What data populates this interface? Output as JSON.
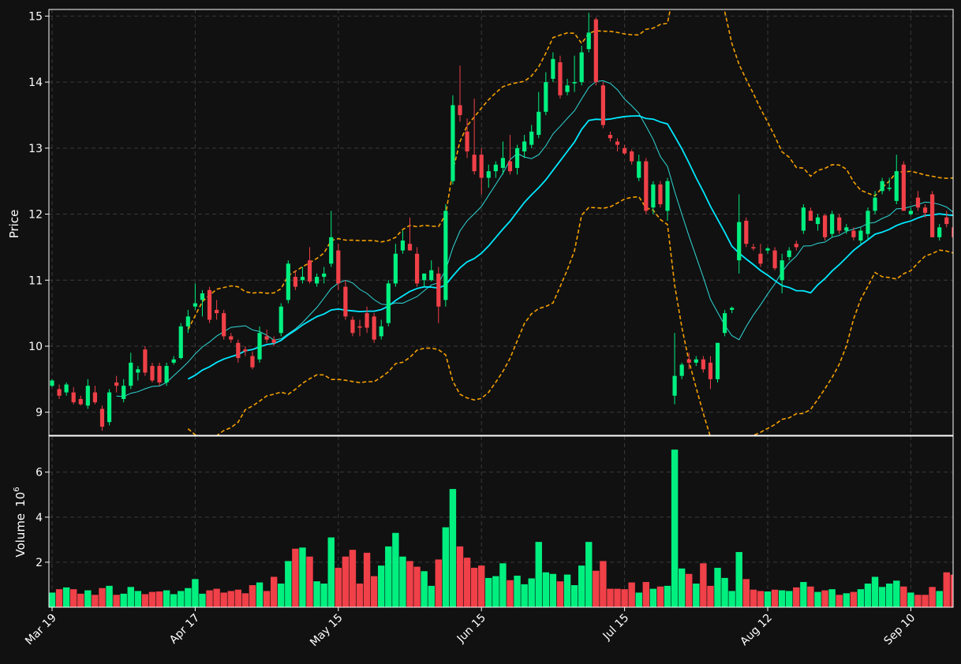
{
  "chart_data": {
    "type": "candlestick",
    "style": "dark",
    "colors": {
      "background": "#111111",
      "grid": "#3a3a3a",
      "up": "#00f080",
      "down": "#f04048",
      "sma_fast": "#30d8d8",
      "sma_slow": "#00e8ff",
      "bollinger": "#f5a000",
      "axis_text": "#ffffff"
    },
    "price_panel": {
      "ylabel": "Price",
      "ylim": [
        8.65,
        15.1
      ],
      "yticks": [
        9,
        10,
        11,
        12,
        13,
        14,
        15
      ],
      "grid": true
    },
    "volume_panel": {
      "ylabel": "Volume",
      "ylabel_exponent": "10",
      "ylabel_exponent_power": "6",
      "ylim": [
        0.0,
        7.6
      ],
      "yticks": [
        2,
        4,
        6
      ],
      "grid": true
    },
    "x_ticks": [
      {
        "index": 0,
        "label": "Mar 19"
      },
      {
        "index": 20,
        "label": "Apr 17"
      },
      {
        "index": 40,
        "label": "May 15"
      },
      {
        "index": 60,
        "label": "Jun 15"
      },
      {
        "index": 80,
        "label": "Jul 15"
      },
      {
        "index": 100,
        "label": "Aug 12"
      },
      {
        "index": 120,
        "label": "Sep 10"
      }
    ],
    "ohlc": [
      [
        9.4,
        9.5,
        9.38,
        9.48
      ],
      [
        9.35,
        9.42,
        9.2,
        9.25
      ],
      [
        9.3,
        9.45,
        9.25,
        9.42
      ],
      [
        9.3,
        9.38,
        9.12,
        9.15
      ],
      [
        9.2,
        9.25,
        9.1,
        9.12
      ],
      [
        9.1,
        9.5,
        9.05,
        9.4
      ],
      [
        9.3,
        9.4,
        9.12,
        9.15
      ],
      [
        9.05,
        9.1,
        8.72,
        8.78
      ],
      [
        8.85,
        9.35,
        8.8,
        9.3
      ],
      [
        9.45,
        9.55,
        9.3,
        9.4
      ],
      [
        9.2,
        9.5,
        9.15,
        9.4
      ],
      [
        9.4,
        9.9,
        9.35,
        9.75
      ],
      [
        9.6,
        9.7,
        9.48,
        9.65
      ],
      [
        9.95,
        10.0,
        9.55,
        9.6
      ],
      [
        9.7,
        9.75,
        9.45,
        9.48
      ],
      [
        9.7,
        9.75,
        9.4,
        9.45
      ],
      [
        9.45,
        9.75,
        9.4,
        9.7
      ],
      [
        9.75,
        9.85,
        9.72,
        9.8
      ],
      [
        9.82,
        10.35,
        9.8,
        10.3
      ],
      [
        10.3,
        10.55,
        10.2,
        10.45
      ],
      [
        10.6,
        10.95,
        10.55,
        10.65
      ],
      [
        10.7,
        10.85,
        10.45,
        10.8
      ],
      [
        10.85,
        10.9,
        10.35,
        10.4
      ],
      [
        10.55,
        10.7,
        10.4,
        10.5
      ],
      [
        10.5,
        10.55,
        10.1,
        10.15
      ],
      [
        10.15,
        10.2,
        10.05,
        10.1
      ],
      [
        10.05,
        10.1,
        9.75,
        9.82
      ],
      [
        9.95,
        10.0,
        9.85,
        9.92
      ],
      [
        9.85,
        9.92,
        9.65,
        9.68
      ],
      [
        9.8,
        10.3,
        9.75,
        10.2
      ],
      [
        10.15,
        10.25,
        10.05,
        10.1
      ],
      [
        10.1,
        10.15,
        10.0,
        10.05
      ],
      [
        10.2,
        10.65,
        10.15,
        10.6
      ],
      [
        10.7,
        11.3,
        10.65,
        11.25
      ],
      [
        11.05,
        11.15,
        10.85,
        10.9
      ],
      [
        11.0,
        11.2,
        10.95,
        11.05
      ],
      [
        11.3,
        11.5,
        10.95,
        10.98
      ],
      [
        10.95,
        11.1,
        10.9,
        11.05
      ],
      [
        11.05,
        11.2,
        10.95,
        11.1
      ],
      [
        11.25,
        12.05,
        11.2,
        11.65
      ],
      [
        11.45,
        11.55,
        10.85,
        10.95
      ],
      [
        10.9,
        11.0,
        10.4,
        10.45
      ],
      [
        10.4,
        10.45,
        10.15,
        10.2
      ],
      [
        10.3,
        10.4,
        10.15,
        10.28
      ],
      [
        10.5,
        10.6,
        10.2,
        10.28
      ],
      [
        10.45,
        10.5,
        10.05,
        10.1
      ],
      [
        10.15,
        10.4,
        10.1,
        10.3
      ],
      [
        10.35,
        11.0,
        10.3,
        10.95
      ],
      [
        10.95,
        11.55,
        10.9,
        11.4
      ],
      [
        11.45,
        11.75,
        11.4,
        11.6
      ],
      [
        11.55,
        11.95,
        11.45,
        11.45
      ],
      [
        11.4,
        11.5,
        10.9,
        10.95
      ],
      [
        11.0,
        11.1,
        10.9,
        11.1
      ],
      [
        11.0,
        11.3,
        10.98,
        11.15
      ],
      [
        11.1,
        11.2,
        10.35,
        10.6
      ],
      [
        10.7,
        12.15,
        10.6,
        12.05
      ],
      [
        12.5,
        13.8,
        12.45,
        13.65
      ],
      [
        13.65,
        14.25,
        13.4,
        13.5
      ],
      [
        13.25,
        13.45,
        12.85,
        12.95
      ],
      [
        12.9,
        13.75,
        12.6,
        12.65
      ],
      [
        12.9,
        13.0,
        12.3,
        12.55
      ],
      [
        12.55,
        12.75,
        12.4,
        12.65
      ],
      [
        12.65,
        12.8,
        12.55,
        12.75
      ],
      [
        12.7,
        13.1,
        12.6,
        12.85
      ],
      [
        12.8,
        13.2,
        12.6,
        12.65
      ],
      [
        12.7,
        13.05,
        12.6,
        13.0
      ],
      [
        12.95,
        13.2,
        12.85,
        13.1
      ],
      [
        13.05,
        13.35,
        13.0,
        13.25
      ],
      [
        13.2,
        13.85,
        13.15,
        13.55
      ],
      [
        13.55,
        14.15,
        13.5,
        14.0
      ],
      [
        14.05,
        14.45,
        14.0,
        14.35
      ],
      [
        14.3,
        14.4,
        13.75,
        13.8
      ],
      [
        13.85,
        14.05,
        13.8,
        13.95
      ],
      [
        13.98,
        14.4,
        13.85,
        14.0
      ],
      [
        14.0,
        14.55,
        13.95,
        14.45
      ],
      [
        14.5,
        15.05,
        14.45,
        14.75
      ],
      [
        14.95,
        14.98,
        13.95,
        14.0
      ],
      [
        13.95,
        14.0,
        13.3,
        13.35
      ],
      [
        13.2,
        13.25,
        13.1,
        13.15
      ],
      [
        13.1,
        13.15,
        12.95,
        13.05
      ],
      [
        13.0,
        13.05,
        12.9,
        12.92
      ],
      [
        12.95,
        12.98,
        12.75,
        12.8
      ],
      [
        12.55,
        12.9,
        12.5,
        12.8
      ],
      [
        12.8,
        12.85,
        12.0,
        12.05
      ],
      [
        12.1,
        12.5,
        12.0,
        12.45
      ],
      [
        12.45,
        12.5,
        12.1,
        12.15
      ],
      [
        12.05,
        12.55,
        11.9,
        12.5
      ],
      [
        9.25,
        10.2,
        9.12,
        9.55
      ],
      [
        9.55,
        9.75,
        9.5,
        9.72
      ],
      [
        9.8,
        9.9,
        9.65,
        9.75
      ],
      [
        9.75,
        9.85,
        9.7,
        9.8
      ],
      [
        9.8,
        9.85,
        9.6,
        9.65
      ],
      [
        9.75,
        9.85,
        9.35,
        9.5
      ],
      [
        9.5,
        10.05,
        9.45,
        10.05
      ],
      [
        10.2,
        10.55,
        10.15,
        10.5
      ],
      [
        10.55,
        10.6,
        10.5,
        10.58
      ],
      [
        11.3,
        12.3,
        11.1,
        11.88
      ],
      [
        11.9,
        11.95,
        11.5,
        11.55
      ],
      [
        11.5,
        11.55,
        11.45,
        11.48
      ],
      [
        11.4,
        11.55,
        11.2,
        11.25
      ],
      [
        11.45,
        11.5,
        11.4,
        11.48
      ],
      [
        11.45,
        11.5,
        11.15,
        11.18
      ],
      [
        11.0,
        11.4,
        10.8,
        11.3
      ],
      [
        11.35,
        11.5,
        11.3,
        11.45
      ],
      [
        11.55,
        11.6,
        11.45,
        11.5
      ],
      [
        11.75,
        12.15,
        11.7,
        12.1
      ],
      [
        12.05,
        12.1,
        11.9,
        11.9
      ],
      [
        11.85,
        12.0,
        11.75,
        11.95
      ],
      [
        11.98,
        12.0,
        11.6,
        11.65
      ],
      [
        11.7,
        12.05,
        11.65,
        12.0
      ],
      [
        11.95,
        12.0,
        11.7,
        11.75
      ],
      [
        11.75,
        11.85,
        11.7,
        11.8
      ],
      [
        11.75,
        11.8,
        11.6,
        11.65
      ],
      [
        11.6,
        11.8,
        11.55,
        11.75
      ],
      [
        11.7,
        12.1,
        11.6,
        12.05
      ],
      [
        12.05,
        12.35,
        12.0,
        12.25
      ],
      [
        12.35,
        12.55,
        12.3,
        12.5
      ],
      [
        12.4,
        12.55,
        12.35,
        12.4
      ],
      [
        12.2,
        12.9,
        12.15,
        12.65
      ],
      [
        12.75,
        12.8,
        12.05,
        12.05
      ],
      [
        12.0,
        12.1,
        11.98,
        12.05
      ],
      [
        12.25,
        12.35,
        12.05,
        12.1
      ],
      [
        12.1,
        12.15,
        11.95,
        12.02
      ],
      [
        12.3,
        12.35,
        11.65,
        11.65
      ],
      [
        11.65,
        11.85,
        11.6,
        11.8
      ],
      [
        11.95,
        12.05,
        11.8,
        11.85
      ],
      [
        11.8,
        11.9,
        11.6,
        11.65
      ]
    ],
    "volume": [
      0.65,
      0.8,
      0.88,
      0.8,
      0.6,
      0.75,
      0.55,
      0.85,
      0.95,
      0.55,
      0.6,
      0.9,
      0.72,
      0.58,
      0.68,
      0.7,
      0.75,
      0.58,
      0.72,
      0.85,
      1.25,
      0.6,
      0.75,
      0.82,
      0.65,
      0.72,
      0.78,
      0.62,
      0.98,
      1.1,
      0.72,
      1.35,
      1.05,
      2.05,
      2.6,
      2.65,
      2.25,
      1.15,
      1.05,
      3.1,
      1.75,
      2.25,
      2.55,
      1.05,
      2.42,
      1.38,
      1.85,
      2.7,
      3.3,
      2.25,
      2.05,
      1.8,
      1.6,
      0.95,
      2.12,
      3.55,
      5.25,
      2.7,
      2.2,
      1.75,
      1.85,
      1.3,
      1.38,
      1.95,
      1.2,
      1.4,
      1.02,
      1.28,
      2.9,
      1.55,
      1.48,
      1.15,
      1.45,
      0.98,
      1.85,
      2.9,
      1.62,
      2.05,
      0.82,
      0.82,
      0.8,
      1.1,
      0.65,
      1.12,
      0.82,
      0.92,
      0.95,
      7.0,
      1.72,
      1.48,
      1.05,
      1.95,
      0.95,
      1.75,
      1.3,
      0.72,
      2.45,
      1.25,
      0.78,
      0.72,
      0.7,
      0.78,
      0.75,
      0.72,
      0.88,
      1.12,
      0.92,
      0.68,
      0.75,
      0.8,
      0.55,
      0.62,
      0.68,
      0.8,
      1.05,
      1.35,
      0.9,
      1.05,
      1.18,
      0.92,
      0.65,
      0.55,
      0.55,
      0.9,
      0.72,
      1.55,
      1.45
    ],
    "sma_fast_window": 10,
    "sma_slow_window": 20,
    "bollinger_window": 20,
    "bollinger_std": 2
  }
}
